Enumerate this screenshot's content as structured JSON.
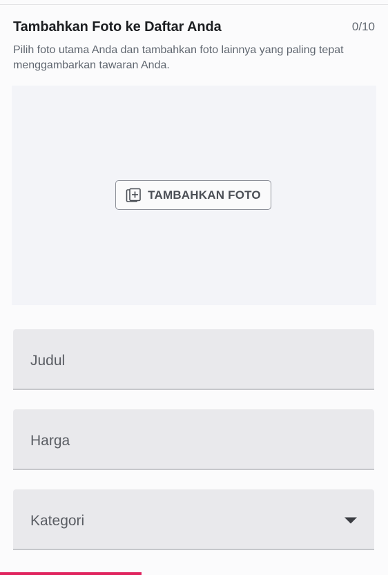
{
  "header": {
    "title": "Tambahkan Foto ke Daftar Anda",
    "counter": "0/10",
    "subtitle": "Pilih foto utama Anda dan tambahkan foto lainnya yang paling tepat menggambarkan tawaran Anda."
  },
  "photo_area": {
    "add_button_label": "TAMBAHKAN FOTO",
    "add_button_icon": "add-photo-icon"
  },
  "form": {
    "title_placeholder": "Judul",
    "price_placeholder": "Harga",
    "category_placeholder": "Kategori",
    "category_icon": "chevron-down-icon"
  },
  "colors": {
    "accent_bar": "#e0245e",
    "field_background": "#e9e9ec",
    "photo_area_background": "#f3f4f8"
  }
}
